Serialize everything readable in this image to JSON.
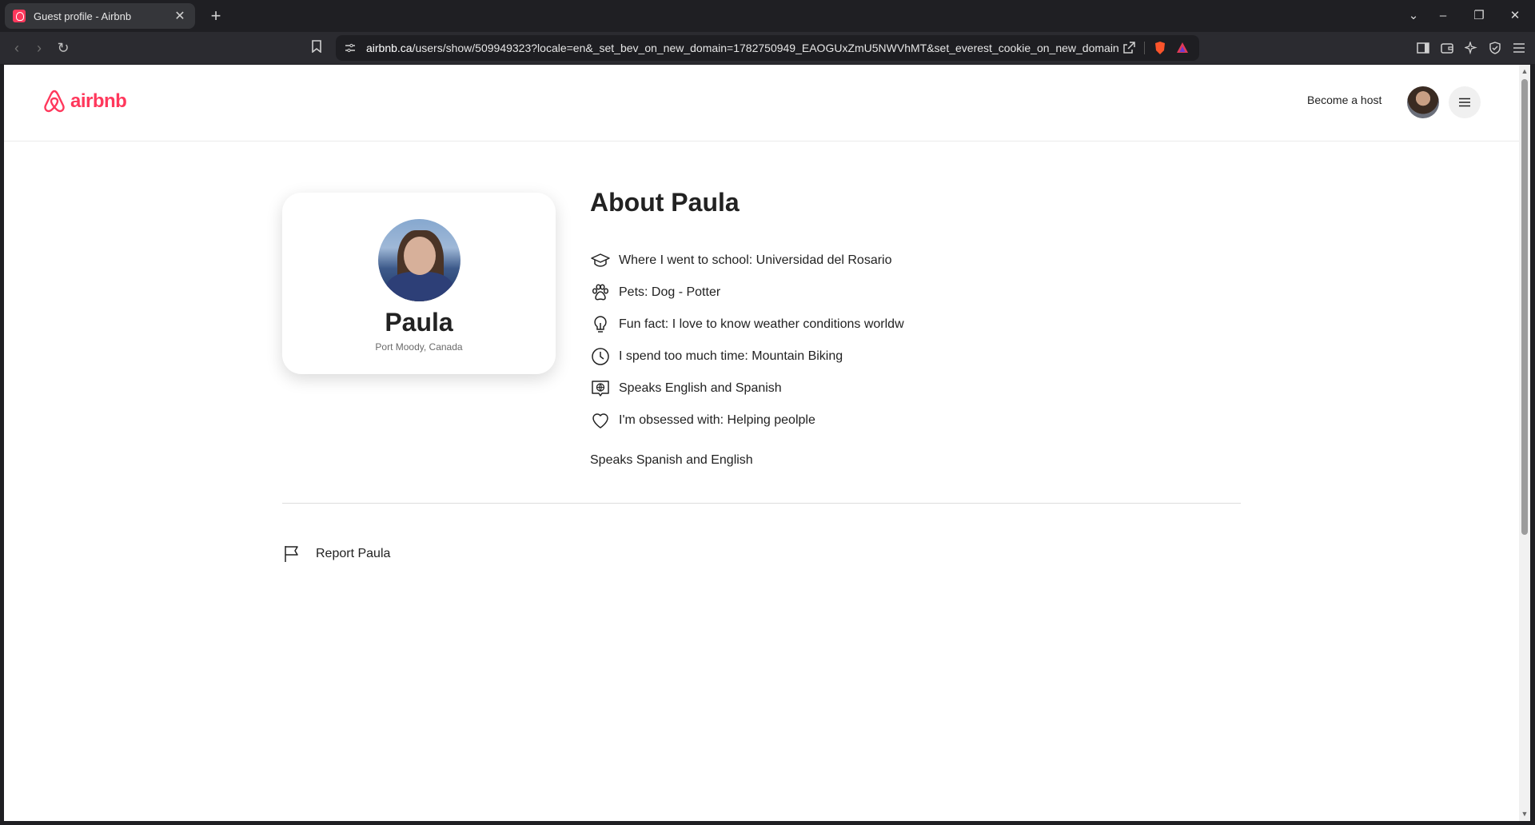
{
  "browser": {
    "tab_title": "Guest profile - Airbnb",
    "url_domain": "airbnb.ca",
    "url_rest": "/users/show/509949323?locale=en&_set_bev_on_new_domain=1782750949_EAOGUxZmU5NWVhMT&set_everest_cookie_on_new_domain..."
  },
  "header": {
    "logo_text": "airbnb",
    "become_host": "Become a host"
  },
  "profile": {
    "name": "Paula",
    "location": "Port Moody, Canada",
    "about_title": "About Paula",
    "facts": [
      {
        "icon": "school-icon",
        "text": "Where I went to school: Universidad del Rosario"
      },
      {
        "icon": "paw-icon",
        "text": "Pets: Dog - Potter"
      },
      {
        "icon": "lightbulb-icon",
        "text": "Fun fact: I love to know weather conditions worldw"
      },
      {
        "icon": "clock-icon",
        "text": "I spend too much time: Mountain Biking"
      },
      {
        "icon": "language-icon",
        "text": "Speaks English and Spanish"
      },
      {
        "icon": "heart-icon",
        "text": "I'm obsessed with: Helping peolple"
      }
    ],
    "bio": "Speaks Spanish and English",
    "report": "Report Paula"
  },
  "colors": {
    "brand": "#ff385c",
    "text": "#222222",
    "muted": "#6a6a6a"
  }
}
